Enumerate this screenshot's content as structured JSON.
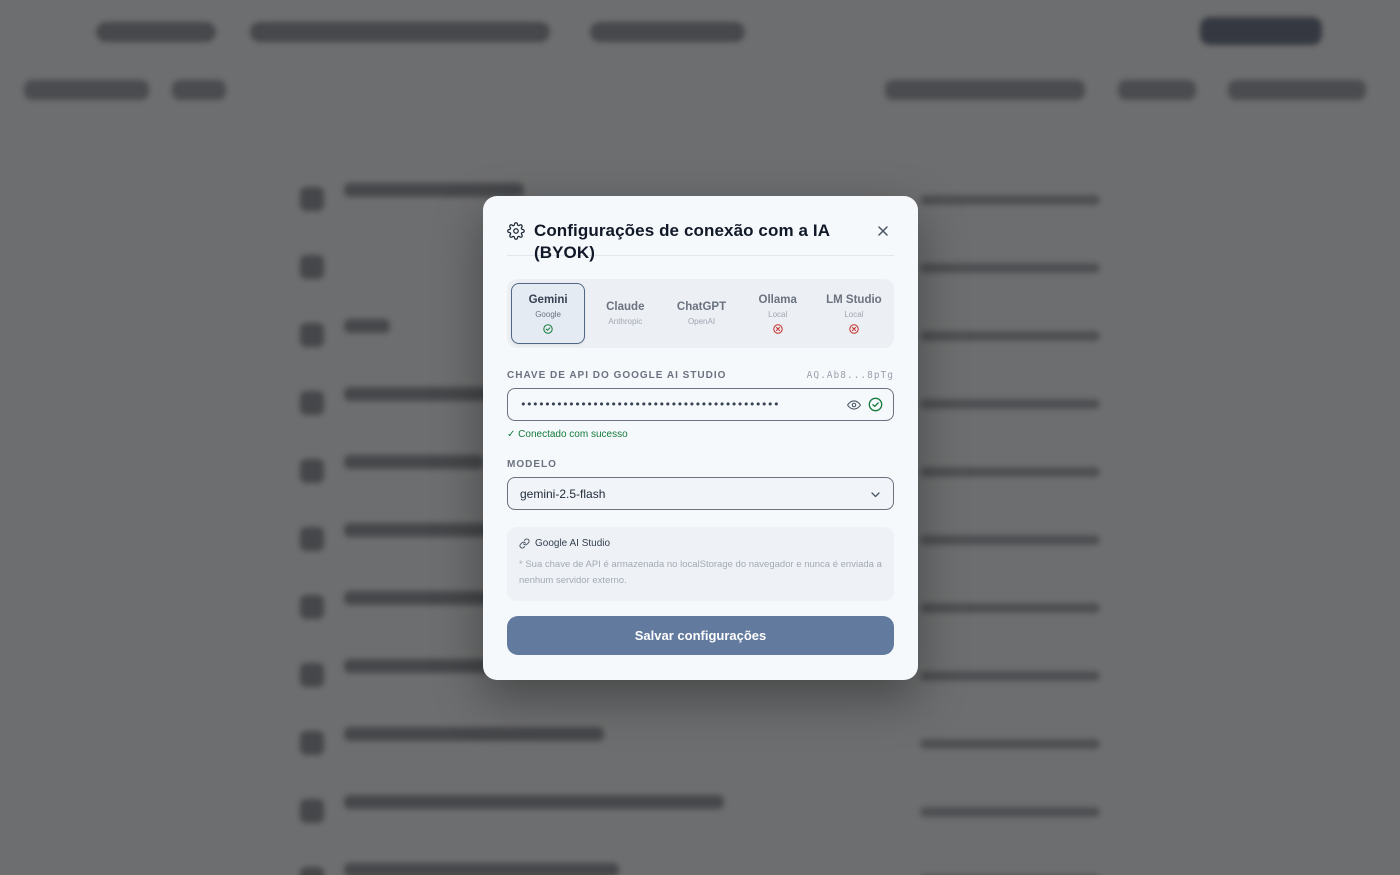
{
  "modal": {
    "title": "Configurações de conexão com a IA (BYOK)",
    "providers": [
      {
        "name": "Gemini",
        "sub": "Google",
        "status": "connected"
      },
      {
        "name": "Claude",
        "sub": "Anthropic",
        "status": "none"
      },
      {
        "name": "ChatGPT",
        "sub": "OpenAI",
        "status": "none"
      },
      {
        "name": "Ollama",
        "sub": "Local",
        "status": "error"
      },
      {
        "name": "LM Studio",
        "sub": "Local",
        "status": "error"
      }
    ],
    "api_key": {
      "label": "CHAVE DE API DO GOOGLE AI STUDIO",
      "masked_hint": "AQ.Ab8...8pTg",
      "value": "•••••••••••••••••••••••••••••••••••••••••••",
      "status_message": "✓ Conectado com sucesso"
    },
    "model": {
      "label": "MODELO",
      "selected": "gemini-2.5-flash"
    },
    "info": {
      "link_label": "Google AI Studio",
      "note": "* Sua chave de API é armazenada no localStorage do navegador e nunca é enviada a nenhum servidor externo."
    },
    "save_label": "Salvar configurações"
  },
  "colors": {
    "accent": "#617a9d",
    "success": "#137a3a",
    "error": "#c62828",
    "scrim": "#3e3e3e"
  }
}
